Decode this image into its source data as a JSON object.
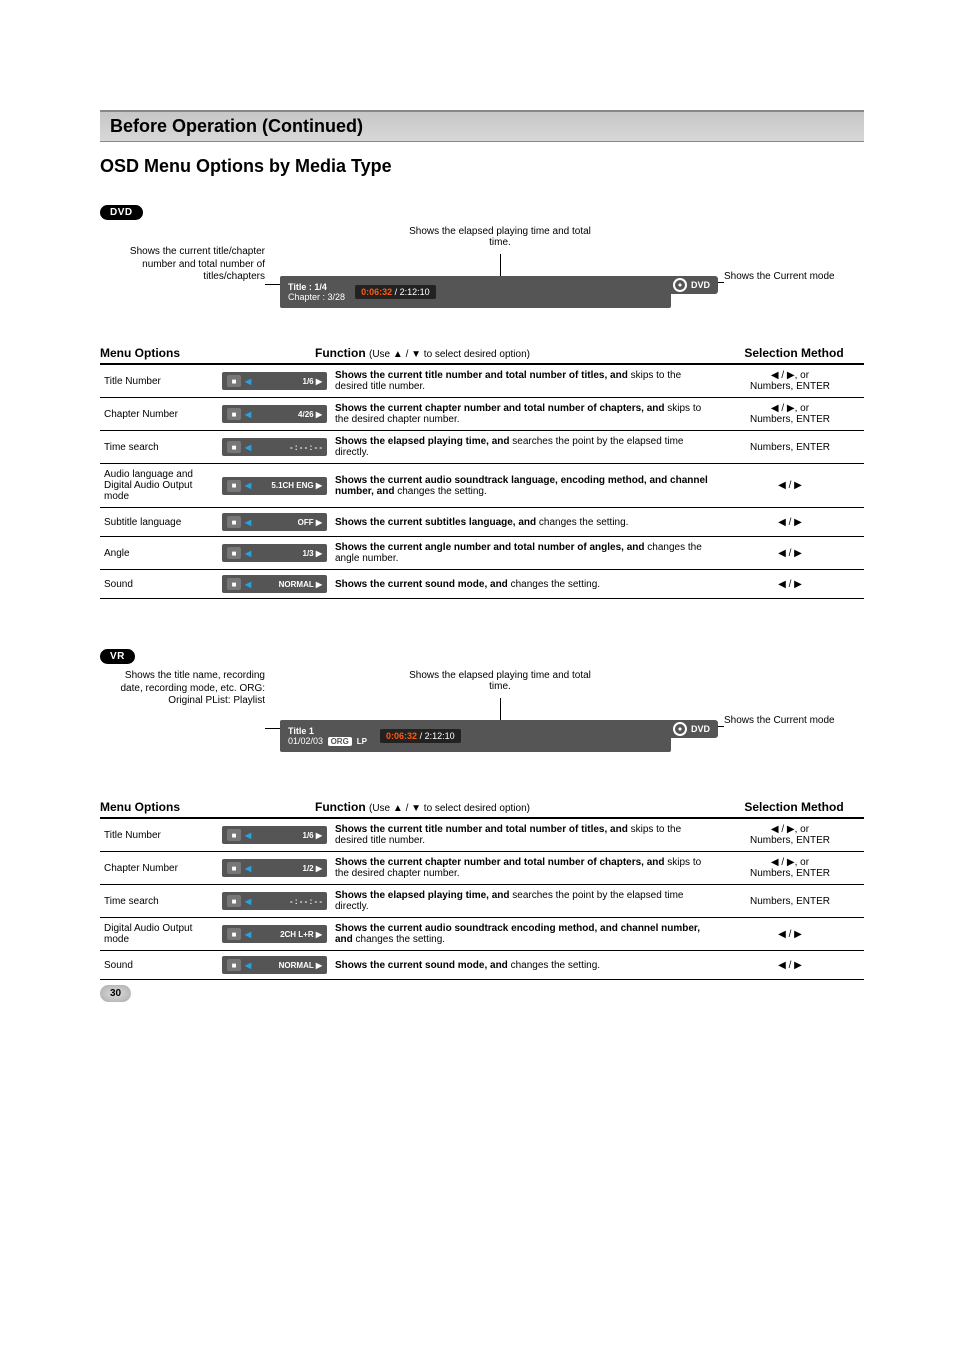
{
  "header": {
    "title": "Before Operation (Continued)",
    "subtitle": "OSD Menu Options by Media Type"
  },
  "sections": [
    {
      "badge": "DVD",
      "leaders": {
        "left": "Shows the current title/chapter number and total number of titles/chapters",
        "top": "Shows the elapsed playing time and total time.",
        "right": "Shows the Current mode"
      },
      "playback": {
        "line1_label": "Title",
        "line1_val": ": 1/4",
        "line2_label": "Chapter",
        "line2_val": ": 3/28",
        "elapsed": "0:06:32",
        "sep": " / ",
        "total": "2:12:10",
        "mode": "DVD"
      },
      "tableHeader": {
        "opt": "Menu Options",
        "func": "Function",
        "func_note": "(Use ▲ / ▼ to select desired option)",
        "sel": "Selection Method"
      },
      "rows": [
        {
          "label": "Title Number",
          "pill_val": "1/6 ▶",
          "func_bold": "Shows the current title number and total number of titles, and",
          "func_rest": " skips to the desired title number.",
          "sel": "◀ / ▶, or Numbers, ENTER"
        },
        {
          "label": "Chapter Number",
          "pill_val": "4/26 ▶",
          "func_bold": "Shows the current chapter number and total number of chapters, and",
          "func_rest": " skips to the desired chapter number.",
          "sel": "◀ / ▶, or Numbers, ENTER"
        },
        {
          "label": "Time search",
          "pill_val": "- : - - : - -",
          "func_bold": "Shows the elapsed playing time, and",
          "func_rest": " searches the point by the elapsed time directly.",
          "sel": "Numbers, ENTER"
        },
        {
          "label": "Audio language and Digital Audio Output mode",
          "pill_val": "5.1CH ENG ▶",
          "func_bold": "Shows the current audio soundtrack language, encoding method, and channel number, and",
          "func_rest": " changes the setting.",
          "sel": "◀ / ▶"
        },
        {
          "label": "Subtitle language",
          "pill_val": "OFF ▶",
          "func_bold": "Shows the current subtitles language, and",
          "func_rest": " changes the setting.",
          "sel": "◀ / ▶"
        },
        {
          "label": "Angle",
          "pill_val": "1/3 ▶",
          "func_bold": "Shows the current angle number and total number of angles, and",
          "func_rest": " changes the angle number.",
          "sel": "◀ / ▶"
        },
        {
          "label": "Sound",
          "pill_val": "NORMAL ▶",
          "func_bold": "Shows the current sound mode, and",
          "func_rest": " changes the setting.",
          "sel": "◀ / ▶"
        }
      ]
    },
    {
      "badge": "VR",
      "leaders": {
        "left": "Shows the title name, recording date, recording mode, etc.\nORG: Original\nPList: Playlist",
        "top": "Shows the elapsed playing time and total time.",
        "right": "Shows the Current mode"
      },
      "playback": {
        "line1_label": "Title 1",
        "line1_val": "",
        "line2_label": "01/02/03",
        "line2_val": "",
        "org_tag": "ORG",
        "lp_tag": "LP",
        "elapsed": "0:06:32",
        "sep": " / ",
        "total": "2:12:10",
        "mode": "DVD"
      },
      "tableHeader": {
        "opt": "Menu Options",
        "func": "Function",
        "func_note": "(Use ▲ / ▼ to select desired option)",
        "sel": "Selection Method"
      },
      "rows": [
        {
          "label": "Title Number",
          "pill_val": "1/6 ▶",
          "func_bold": "Shows the current title number and total number of titles, and",
          "func_rest": " skips to the desired title number.",
          "sel": "◀ / ▶, or Numbers, ENTER"
        },
        {
          "label": "Chapter Number",
          "pill_val": "1/2 ▶",
          "func_bold": "Shows the current chapter number and total number of chapters, and",
          "func_rest": " skips to the desired chapter number.",
          "sel": "◀ / ▶, or Numbers, ENTER"
        },
        {
          "label": "Time search",
          "pill_val": "- : - - : - -",
          "func_bold": "Shows the elapsed playing time, and",
          "func_rest": " searches the point by the elapsed time directly.",
          "sel": "Numbers, ENTER"
        },
        {
          "label": "Digital Audio Output mode",
          "pill_val": "2CH L+R ▶",
          "func_bold": "Shows the current audio soundtrack encoding method, and channel number, and",
          "func_rest": " changes the setting.",
          "sel": "◀ / ▶"
        },
        {
          "label": "Sound",
          "pill_val": "NORMAL ▶",
          "func_bold": "Shows the current sound mode, and",
          "func_rest": " changes the setting.",
          "sel": "◀ / ▶"
        }
      ]
    }
  ],
  "pageNumber": "30"
}
